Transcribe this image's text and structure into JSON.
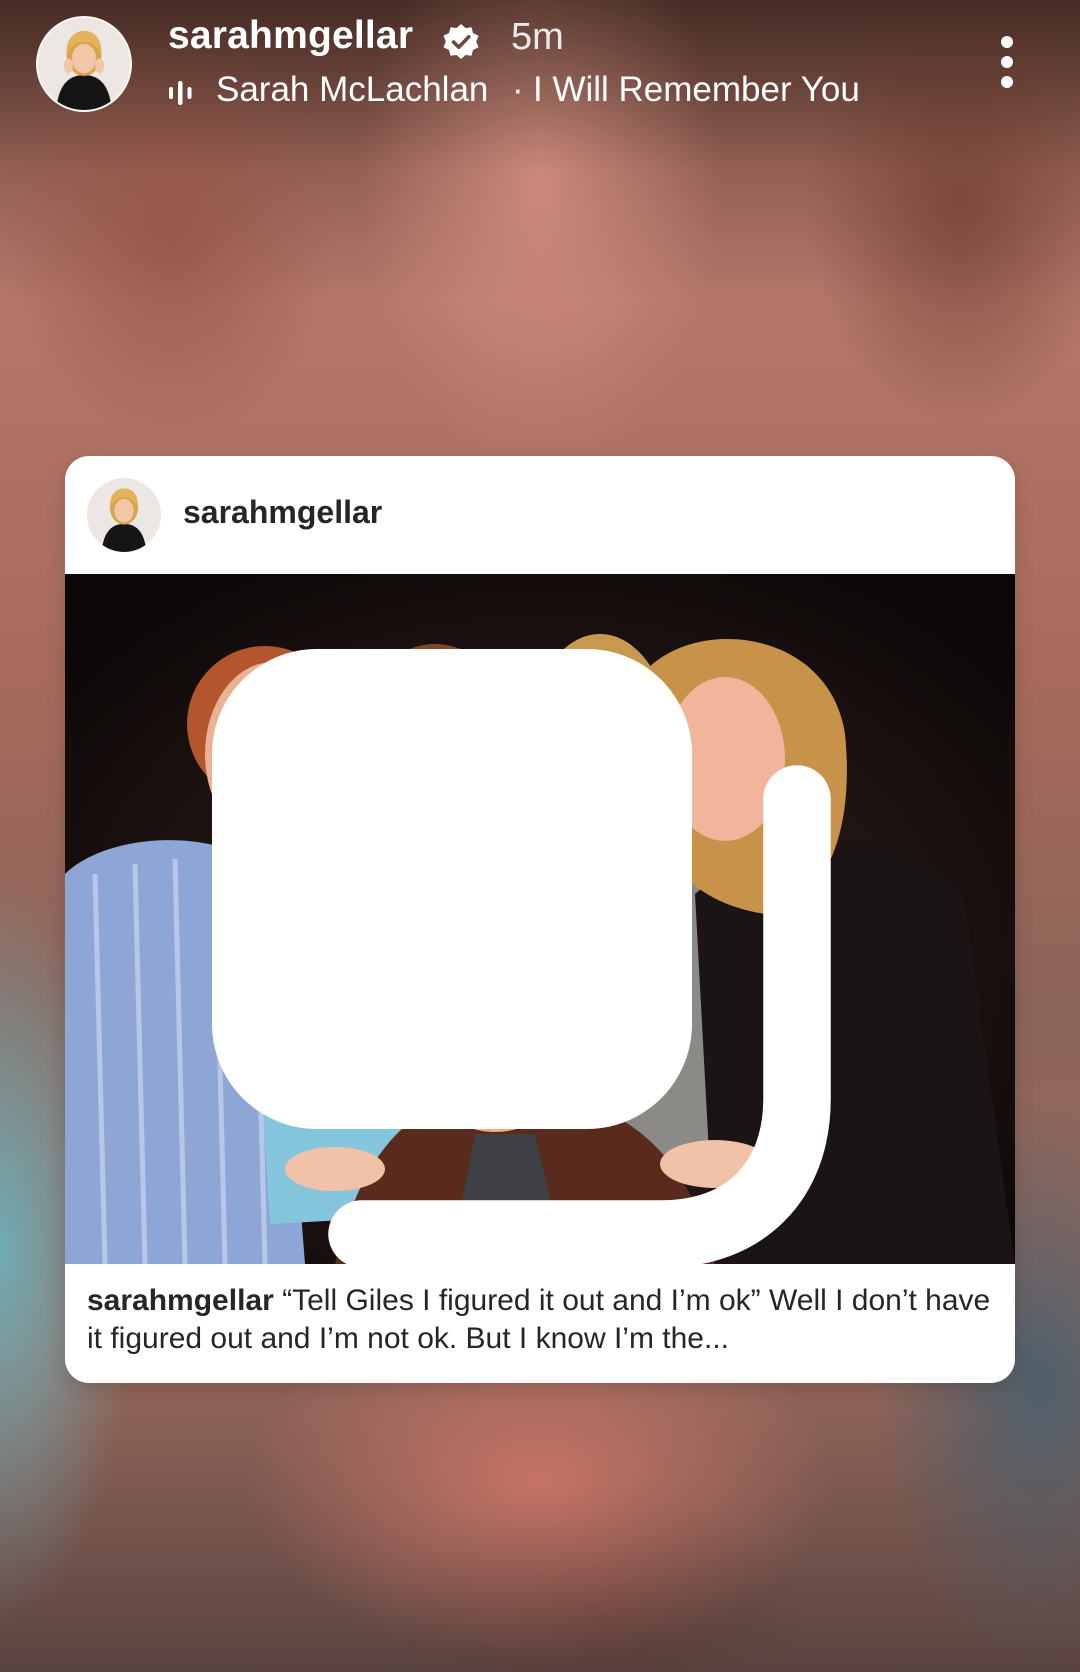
{
  "story": {
    "username": "sarahmgellar",
    "verified": true,
    "timestamp": "5m",
    "music": {
      "artist": "Sarah McLachlan",
      "separator": "·",
      "track": "I Will Remember You"
    },
    "more_icon": "more-vertical-icon"
  },
  "post": {
    "username": "sarahmgellar",
    "carousel_icon": "carousel-icon",
    "caption_text": "“Tell Giles I figured it out and I’m ok” Well I don’t have it figured out and I’m not ok. But I know I’m the..."
  },
  "colors": {
    "card_background": "#ffffff",
    "text_primary": "#262626",
    "verified_badge": "#ffffff"
  }
}
